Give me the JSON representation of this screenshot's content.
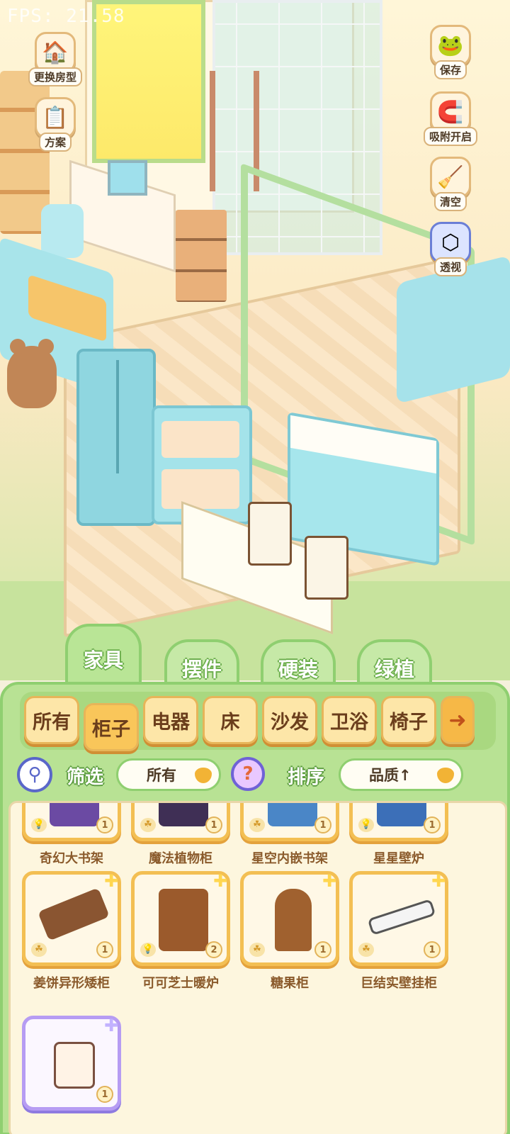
{
  "fps_text": "FPS: 21.58",
  "left_buttons": [
    {
      "label": "更换房型",
      "icon": "house-icon"
    },
    {
      "label": "方案",
      "icon": "blueprint-icon"
    }
  ],
  "right_buttons": [
    {
      "label": "保存",
      "icon": "frog-save-icon"
    },
    {
      "label": "吸附开启",
      "icon": "magnet-snap-icon"
    },
    {
      "label": "清空",
      "icon": "broom-clear-icon"
    },
    {
      "label": "透视",
      "icon": "cube-view-icon"
    }
  ],
  "category_tabs": [
    {
      "label": "家具",
      "active": true
    },
    {
      "label": "摆件",
      "active": false
    },
    {
      "label": "硬装",
      "active": false
    },
    {
      "label": "绿植",
      "active": false
    }
  ],
  "subtabs": [
    {
      "label": "所有"
    },
    {
      "label": "柜子",
      "active": true
    },
    {
      "label": "电器"
    },
    {
      "label": "床"
    },
    {
      "label": "沙发"
    },
    {
      "label": "卫浴"
    },
    {
      "label": "椅子"
    }
  ],
  "subtab_more_icon": "arrow-right-icon",
  "filter": {
    "label": "筛选",
    "value": "所有",
    "sort_label": "排序",
    "sort_value": "品质↑"
  },
  "items": [
    {
      "name": "奇幻大书架",
      "count": "1",
      "tag": "bulb",
      "rarity": "gold"
    },
    {
      "name": "魔法植物柜",
      "count": "1",
      "tag": "leaf",
      "rarity": "gold"
    },
    {
      "name": "星空内嵌书架",
      "count": "1",
      "tag": "leaf",
      "rarity": "gold"
    },
    {
      "name": "星星壁炉",
      "count": "1",
      "tag": "bulb",
      "rarity": "gold"
    },
    {
      "name": "姜饼异形矮柜",
      "count": "1",
      "tag": "leaf",
      "rarity": "gold"
    },
    {
      "name": "可可芝士暖炉",
      "count": "2",
      "tag": "bulb",
      "rarity": "gold"
    },
    {
      "name": "糖果柜",
      "count": "1",
      "tag": "leaf",
      "rarity": "gold"
    },
    {
      "name": "巨结实壁挂柜",
      "count": "1",
      "tag": "leaf",
      "rarity": "gold"
    },
    {
      "name": "",
      "count": "1",
      "tag": "",
      "rarity": "purple"
    }
  ],
  "colors": {
    "panel_green": "#b8e294",
    "tab_orange": "#fde6a8",
    "card_gold": "#f3bf53",
    "card_purple": "#b69cf3"
  }
}
